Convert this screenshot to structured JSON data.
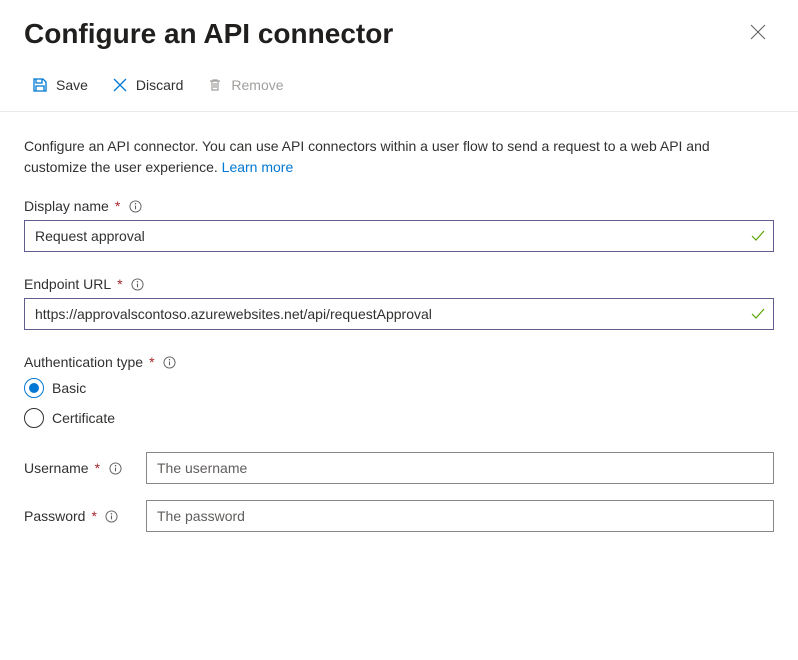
{
  "header": {
    "title": "Configure an API connector"
  },
  "toolbar": {
    "save_label": "Save",
    "discard_label": "Discard",
    "remove_label": "Remove"
  },
  "description": {
    "text": "Configure an API connector. You can use API connectors within a user flow to send a request to a web API and customize the user experience. ",
    "link_label": "Learn more"
  },
  "fields": {
    "display_name": {
      "label": "Display name",
      "value": "Request approval"
    },
    "endpoint_url": {
      "label": "Endpoint URL",
      "value": "https://approvalscontoso.azurewebsites.net/api/requestApproval"
    },
    "auth_type": {
      "label": "Authentication type",
      "options": {
        "basic": "Basic",
        "certificate": "Certificate"
      }
    },
    "username": {
      "label": "Username",
      "placeholder": "The username"
    },
    "password": {
      "label": "Password",
      "placeholder": "The password"
    }
  }
}
